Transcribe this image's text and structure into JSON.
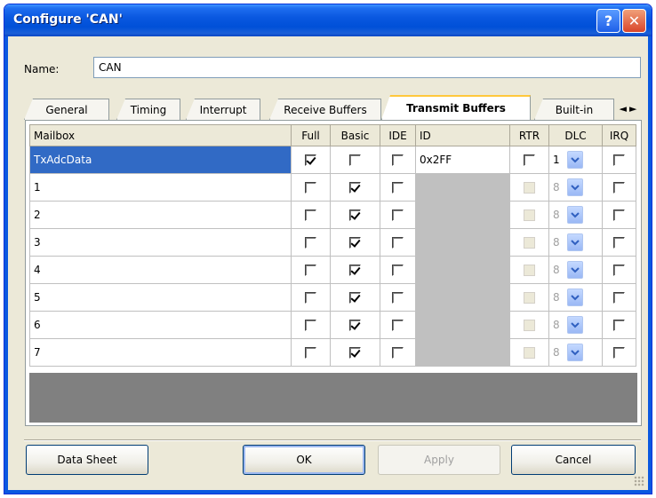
{
  "window": {
    "title": "Configure 'CAN'"
  },
  "titlebar": {
    "help_label": "?",
    "close_label": "✕"
  },
  "name_field": {
    "label": "Name:",
    "value": "CAN"
  },
  "tabs": [
    {
      "label": "General"
    },
    {
      "label": "Timing"
    },
    {
      "label": "Interrupt"
    },
    {
      "label": "Receive Buffers"
    },
    {
      "label": "Transmit Buffers"
    },
    {
      "label": "Built-in"
    }
  ],
  "active_tab": "Transmit Buffers",
  "tab_scroll": {
    "left": "◄",
    "right": "►"
  },
  "table": {
    "columns": [
      "Mailbox",
      "Full",
      "Basic",
      "IDE",
      "ID",
      "RTR",
      "DLC",
      "IRQ"
    ],
    "rows": [
      {
        "mailbox": "TxAdcData",
        "full": true,
        "basic": false,
        "ide": false,
        "id": "0x2FF",
        "rtr": false,
        "dlc": "1",
        "irq": false,
        "selected": true,
        "id_enabled": true
      },
      {
        "mailbox": "1",
        "full": false,
        "basic": true,
        "ide": false,
        "id": "",
        "rtr": false,
        "dlc": "8",
        "irq": false,
        "selected": false,
        "id_enabled": false
      },
      {
        "mailbox": "2",
        "full": false,
        "basic": true,
        "ide": false,
        "id": "",
        "rtr": false,
        "dlc": "8",
        "irq": false,
        "selected": false,
        "id_enabled": false
      },
      {
        "mailbox": "3",
        "full": false,
        "basic": true,
        "ide": false,
        "id": "",
        "rtr": false,
        "dlc": "8",
        "irq": false,
        "selected": false,
        "id_enabled": false
      },
      {
        "mailbox": "4",
        "full": false,
        "basic": true,
        "ide": false,
        "id": "",
        "rtr": false,
        "dlc": "8",
        "irq": false,
        "selected": false,
        "id_enabled": false
      },
      {
        "mailbox": "5",
        "full": false,
        "basic": true,
        "ide": false,
        "id": "",
        "rtr": false,
        "dlc": "8",
        "irq": false,
        "selected": false,
        "id_enabled": false
      },
      {
        "mailbox": "6",
        "full": false,
        "basic": true,
        "ide": false,
        "id": "",
        "rtr": false,
        "dlc": "8",
        "irq": false,
        "selected": false,
        "id_enabled": false
      },
      {
        "mailbox": "7",
        "full": false,
        "basic": true,
        "ide": false,
        "id": "",
        "rtr": false,
        "dlc": "8",
        "irq": false,
        "selected": false,
        "id_enabled": false
      }
    ]
  },
  "buttons": {
    "data_sheet": "Data Sheet",
    "ok": "OK",
    "apply": "Apply",
    "cancel": "Cancel"
  },
  "colors": {
    "titlebar": "#0a58e0",
    "selection": "#316ac5",
    "disabled_cell": "#c0c0c0",
    "empty_area": "#808080"
  }
}
